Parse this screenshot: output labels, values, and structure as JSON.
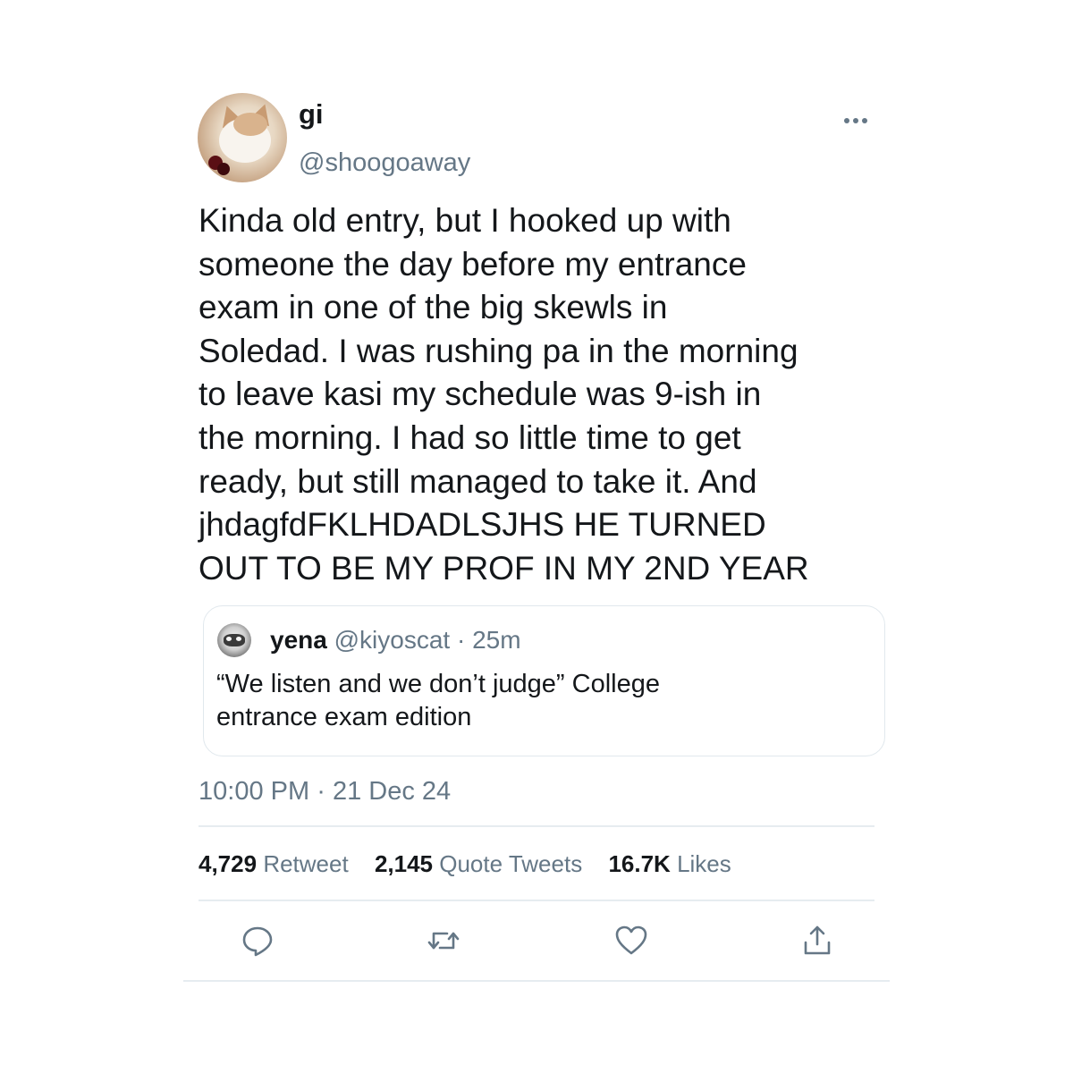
{
  "author": {
    "display_name": "gi",
    "handle": "@shoogoaway"
  },
  "tweet": {
    "lines": [
      "Kinda old entry, but I hooked up with",
      "someone the day before my entrance",
      "exam in one of the big skewls in",
      "Soledad. I was rushing pa in the morning",
      "to leave kasi my schedule was 9-ish in",
      "the morning. I had so little time to get",
      "ready, but still managed to take it. And",
      "jhdagfdFKLHDADLSJHS HE TURNED",
      "OUT TO BE MY PROF IN MY 2ND YEAR"
    ]
  },
  "quoted_tweet": {
    "display_name": "yena",
    "handle": "@kiyoscat",
    "separator": "·",
    "time": "25m",
    "lines": [
      "“We listen and we don’t judge” College",
      "entrance exam edition"
    ]
  },
  "meta": {
    "time": "10:00 PM",
    "separator": "·",
    "date": "21 Dec 24"
  },
  "stats": {
    "retweets_count": "4,729",
    "retweets_label": "Retweet",
    "quotes_count": "2,145",
    "quotes_label": "Quote Tweets",
    "likes_count": "16.7K",
    "likes_label": "Likes"
  },
  "icons": {
    "more": "more-horizontal-icon",
    "reply": "reply-icon",
    "retweet": "retweet-icon",
    "like": "heart-icon",
    "share": "share-icon"
  },
  "colors": {
    "text": "#14171a",
    "secondary": "#657786",
    "border": "#e1e8ed",
    "icon": "#657786"
  }
}
